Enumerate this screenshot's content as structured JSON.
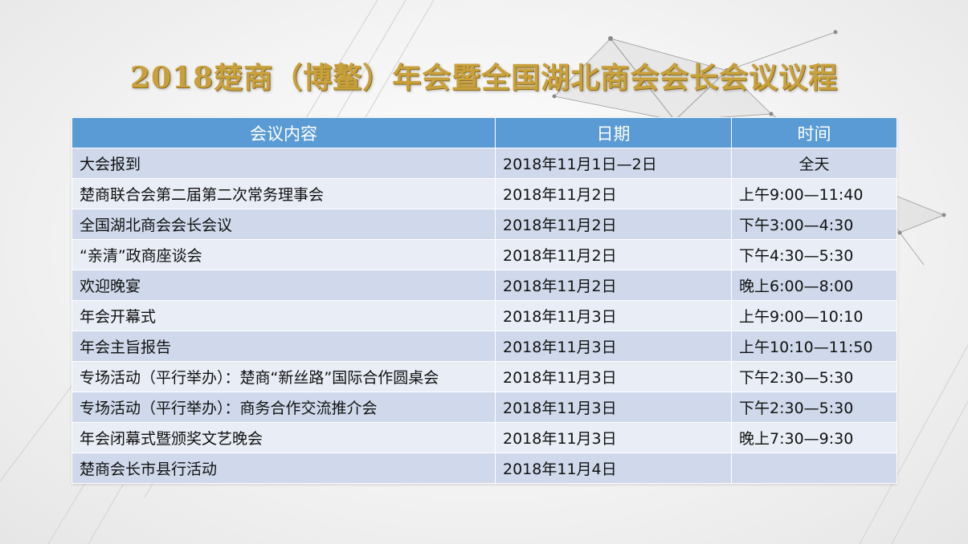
{
  "title": "2018楚商（博鳌）年会暨全国湖北商会会长会议议程",
  "table": {
    "headers": [
      "会议内容",
      "日期",
      "时间"
    ],
    "rows": [
      {
        "content": "大会报到",
        "date": "2018年11月1日—2日",
        "time": "全天"
      },
      {
        "content": "楚商联合会第二届第二次常务理事会",
        "date": "2018年11月2日",
        "time": "上午9:00—11:40"
      },
      {
        "content": "全国湖北商会会长会议",
        "date": "2018年11月2日",
        "time": "下午3:00—4:30"
      },
      {
        "content": "“亲清”政商座谈会",
        "date": "2018年11月2日",
        "time": "下午4:30—5:30"
      },
      {
        "content": "欢迎晚宴",
        "date": "2018年11月2日",
        "time": "晚上6:00—8:00"
      },
      {
        "content": "年会开幕式",
        "date": "2018年11月3日",
        "time": "上午9:00—10:10"
      },
      {
        "content": "年会主旨报告",
        "date": "2018年11月3日",
        "time": "上午10:10—11:50"
      },
      {
        "content": "专场活动（平行举办）：楚商“新丝路”国际合作圆桌会",
        "date": "2018年11月3日",
        "time": "下午2:30—5:30"
      },
      {
        "content": "专场活动（平行举办）：商务合作交流推介会",
        "date": "2018年11月3日",
        "time": "下午2:30—5:30"
      },
      {
        "content": "年会闭幕式暨颁奖文艺晚会",
        "date": "2018年11月3日",
        "time": "晚上7:30—9:30"
      },
      {
        "content": "楚商会长市县行活动",
        "date": "2018年11月4日",
        "time": ""
      }
    ]
  }
}
